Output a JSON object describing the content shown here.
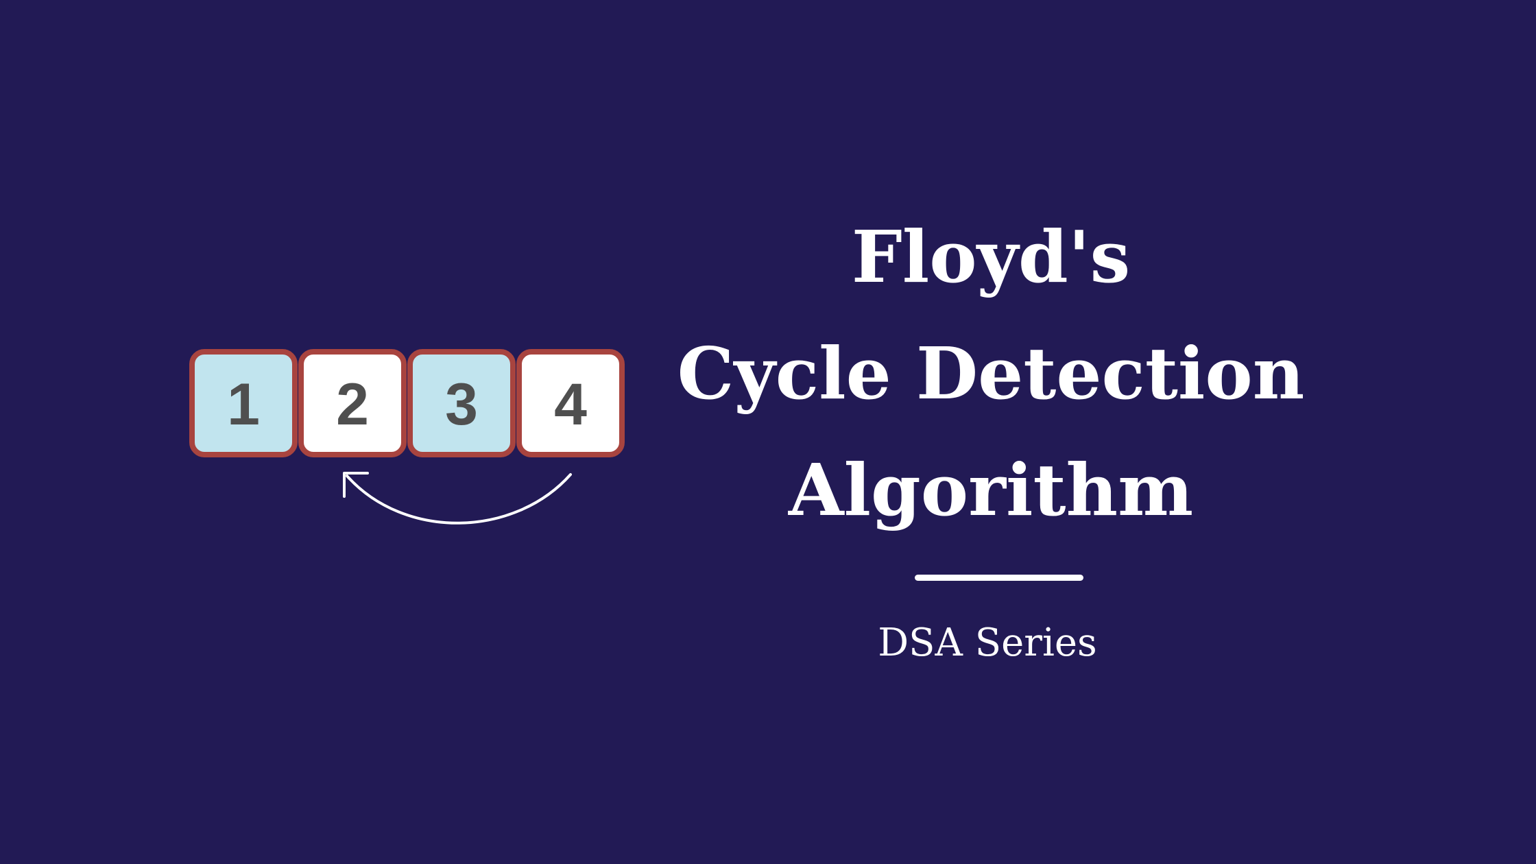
{
  "title": {
    "line1": "Floyd's",
    "line2": "Cycle Detection",
    "line3": "Algorithm"
  },
  "subtitle": "DSA Series",
  "nodes": [
    {
      "value": "1",
      "fill": "#c1e4ee"
    },
    {
      "value": "2",
      "fill": "#ffffff"
    },
    {
      "value": "3",
      "fill": "#c1e4ee"
    },
    {
      "value": "4",
      "fill": "#ffffff"
    }
  ],
  "colors": {
    "background": "#221a55",
    "node_border": "#a8443f",
    "node_text": "#4f4f4f",
    "text": "#ffffff"
  },
  "icons": {
    "cycle_arrow": "curved-back-arrow-icon"
  }
}
